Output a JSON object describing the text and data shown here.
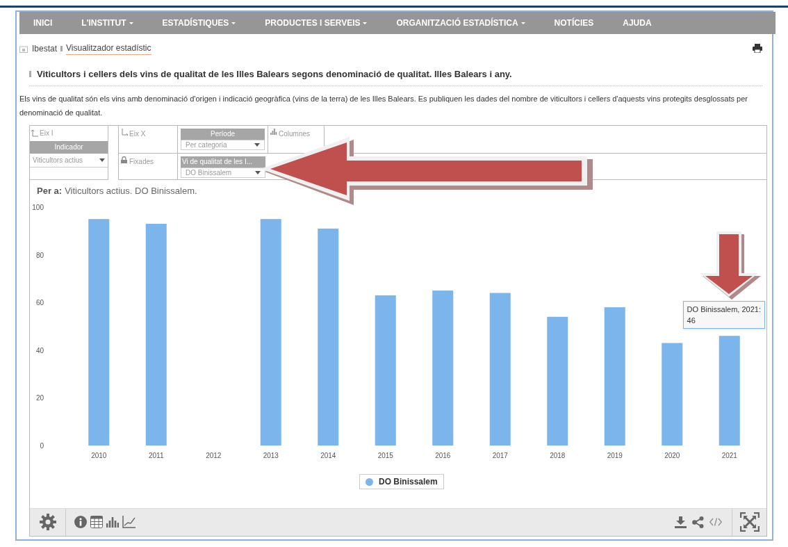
{
  "nav": [
    {
      "label": "INICI",
      "has_menu": false
    },
    {
      "label": "L'INSTITUT",
      "has_menu": true
    },
    {
      "label": "ESTADÍSTIQUES",
      "has_menu": true
    },
    {
      "label": "PRODUCTES I SERVEIS",
      "has_menu": true
    },
    {
      "label": "ORGANITZACIÓ ESTADÍSTICA",
      "has_menu": true
    },
    {
      "label": "NOTÍCIES",
      "has_menu": false
    },
    {
      "label": "AJUDA",
      "has_menu": false
    }
  ],
  "breadcrumb": [
    "Ibestat",
    "Visualitzador estadístic"
  ],
  "title": "Viticultors i cellers dels vins de qualitat de les Illes Balears segons denominació de qualitat. Illes Balears i any.",
  "description": "Els vins de qualitat són els vins amb denominació d'origen i indicació geogràfica (vins de la terra) de les Illes Balears. Es publiquen les dades del nombre de viticultors i cellers d'aquests vins protegits desglossats per denominació de qualitat.",
  "controls": {
    "axis_i": {
      "label": "Eix I",
      "header": "Indicador",
      "value": "Viticultors actius"
    },
    "axis_x": {
      "label": "Eix X",
      "header": "Període",
      "value": "Per categoria"
    },
    "columns": {
      "label": "Columnes"
    },
    "fixed": {
      "label": "Fixades",
      "header": "Vi de qualitat de les I...",
      "value": "DO Binissalem"
    }
  },
  "chart": {
    "per_label": "Per a:",
    "per_value": "Viticultors actius. DO Binissalem.",
    "chart_data": {
      "type": "bar",
      "categories": [
        "2010",
        "2011",
        "2012",
        "2013",
        "2014",
        "2015",
        "2016",
        "2017",
        "2018",
        "2019",
        "2020",
        "2021"
      ],
      "series": [
        {
          "name": "DO Binissalem",
          "color": "#7cb5ec",
          "values": [
            95,
            93,
            null,
            95,
            91,
            63,
            65,
            64,
            54,
            58,
            43,
            46
          ]
        }
      ],
      "ylim": [
        0,
        100
      ],
      "yticks": [
        0,
        20,
        40,
        60,
        80,
        100
      ]
    },
    "tooltip": {
      "title": "DO Binissalem, 2021:",
      "value": "46"
    }
  }
}
